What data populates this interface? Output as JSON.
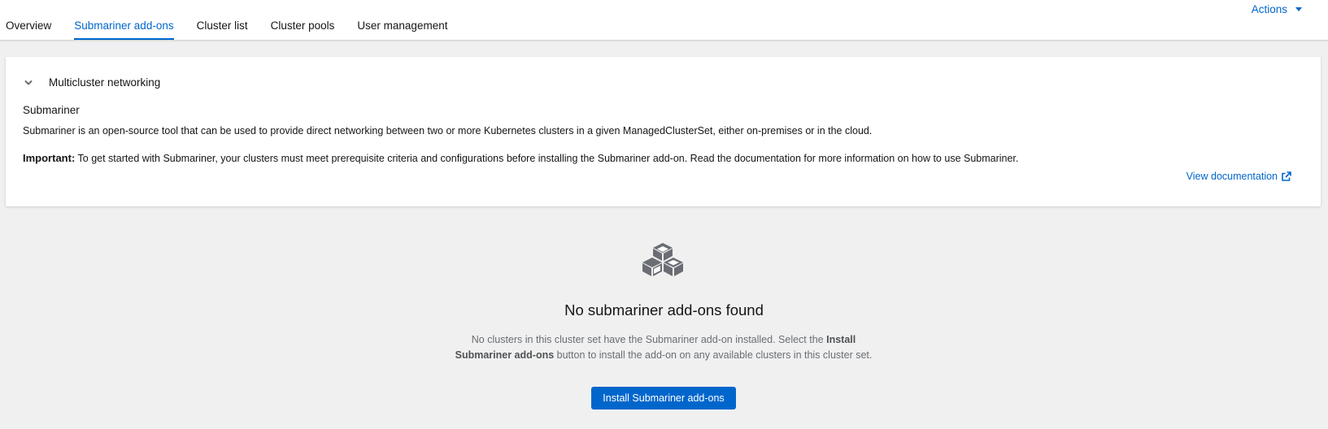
{
  "tabs": [
    {
      "label": "Overview",
      "active": false
    },
    {
      "label": "Submariner add-ons",
      "active": true
    },
    {
      "label": "Cluster list",
      "active": false
    },
    {
      "label": "Cluster pools",
      "active": false
    },
    {
      "label": "User management",
      "active": false
    }
  ],
  "header": {
    "actions_label": "Actions"
  },
  "card": {
    "toggle_title": "Multicluster networking",
    "subtitle": "Submariner",
    "description": "Submariner is an open-source tool that can be used to provide direct networking between two or more Kubernetes clusters in a given ManagedClusterSet, either on-premises or in the cloud.",
    "important_label": "Important:",
    "important_text": " To get started with Submariner, your clusters must meet prerequisite criteria and configurations before installing the Submariner add-on. Read the documentation for more information on how to use Submariner.",
    "doc_link": "View documentation",
    "doc_icon": "external-link-icon"
  },
  "empty_state": {
    "icon": "cubes-icon",
    "title": "No submariner add-ons found",
    "body_part1": "No clusters in this cluster set have the Submariner add-on installed. Select the ",
    "body_bold": "Install Submariner add-ons",
    "body_part2": " button to install the add-on on any available clusters in this cluster set.",
    "button_label": "Install Submariner add-ons"
  },
  "colors": {
    "accent": "#0066cc",
    "background": "#f0f0f0",
    "card": "#ffffff",
    "muted_text": "#6a6e73"
  }
}
